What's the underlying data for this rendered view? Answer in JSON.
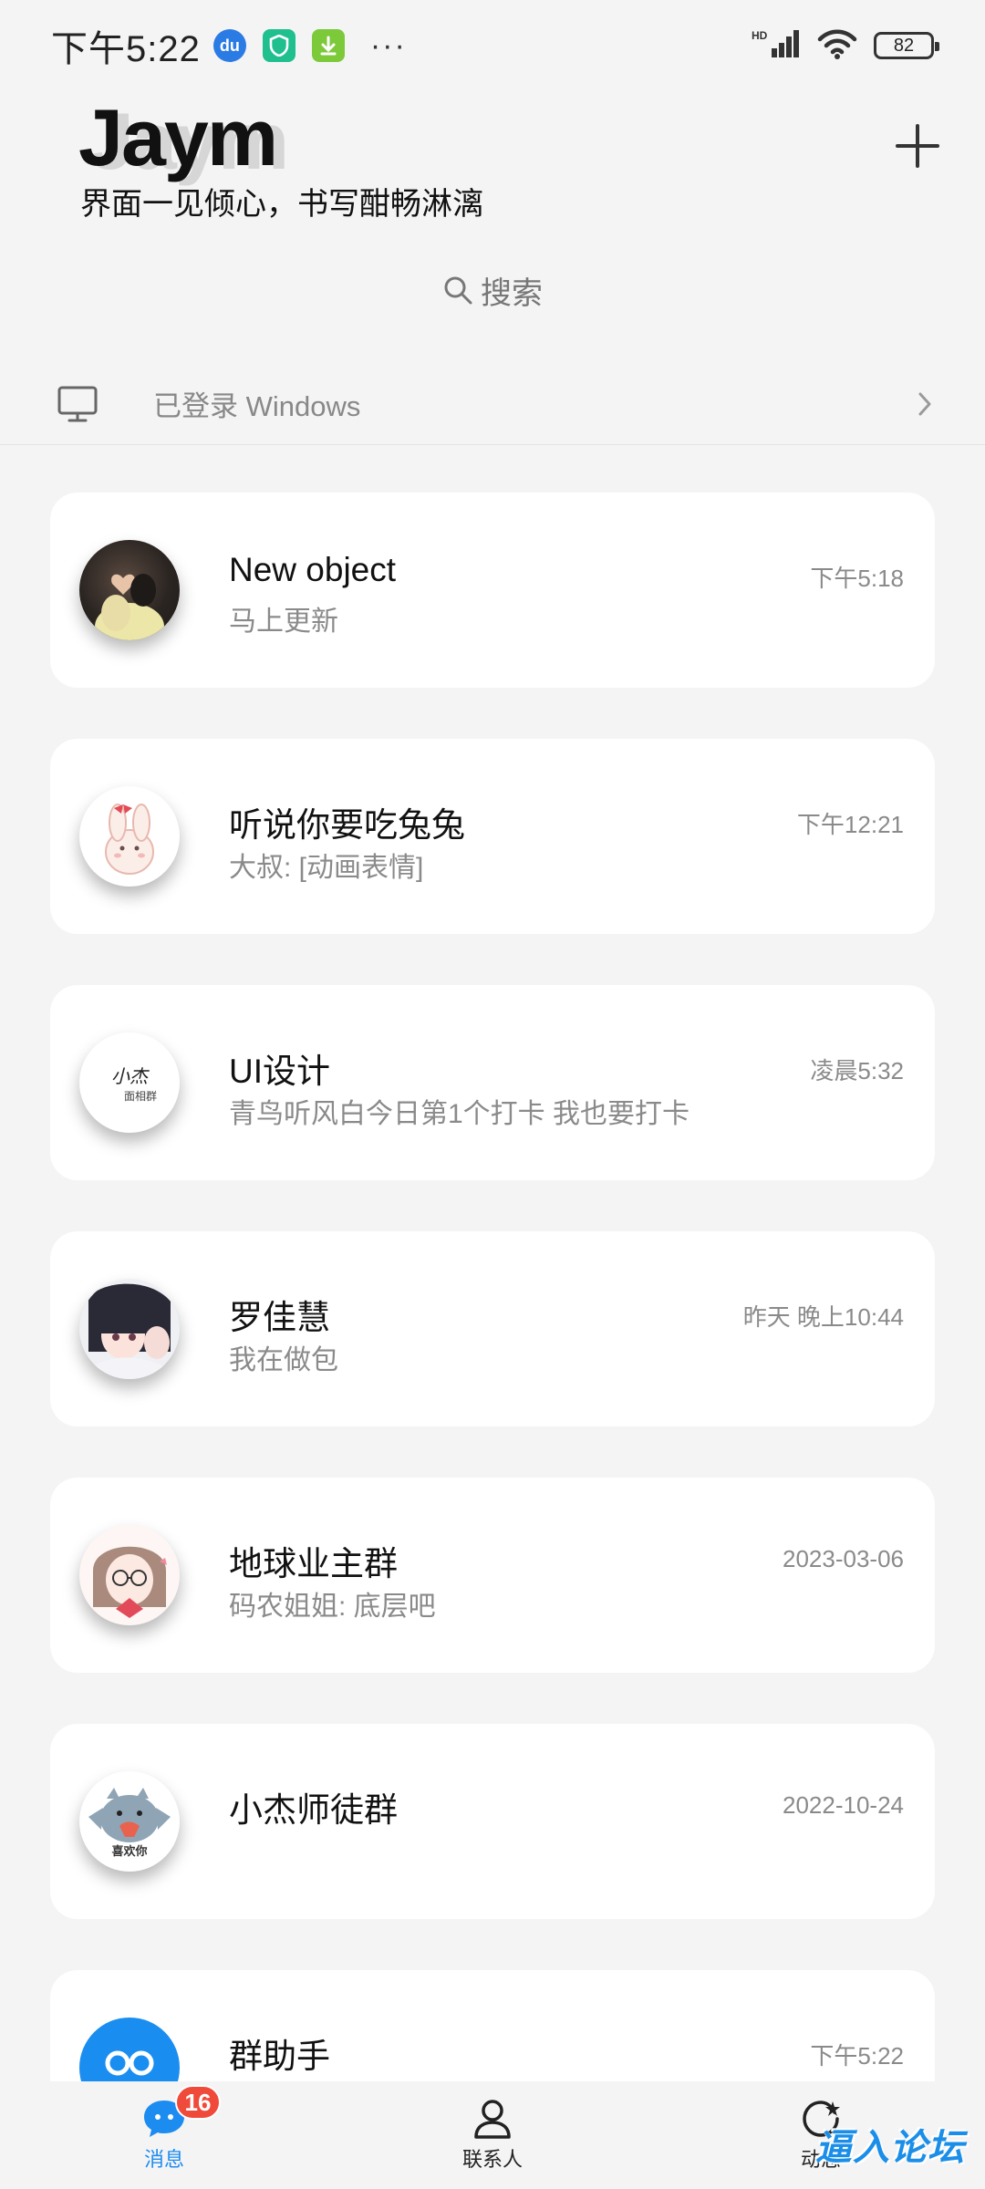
{
  "status_bar": {
    "time": "下午5:22",
    "apps": [
      "du",
      "shield-app",
      "download-app"
    ],
    "more": "···",
    "network": "HD",
    "battery": "82"
  },
  "header": {
    "title": "Jaym",
    "subtitle": "界面一见倾心，书写酣畅淋漓",
    "add_icon": "plus-icon"
  },
  "search": {
    "placeholder": "搜索",
    "icon": "search-icon"
  },
  "login_row": {
    "text": "已登录 Windows",
    "icon": "monitor-icon"
  },
  "chats": [
    {
      "name": "New object",
      "preview": "马上更新",
      "time": "下午5:18"
    },
    {
      "name": "听说你要吃兔兔",
      "preview": "大叔: [动画表情]",
      "time": "下午12:21"
    },
    {
      "name": "UI设计",
      "preview": "青鸟听风白今日第1个打卡  我也要打卡",
      "time": "凌晨5:32"
    },
    {
      "name": "罗佳慧",
      "preview": "我在做包",
      "time": "昨天 晚上10:44"
    },
    {
      "name": "地球业主群",
      "preview": "码农姐姐: 底层吧",
      "time": "2023-03-06"
    },
    {
      "name": "小杰师徒群",
      "preview": "",
      "time": "2022-10-24"
    },
    {
      "name": "群助手",
      "preview": "",
      "time": "下午5:22"
    }
  ],
  "avatar_texts": {
    "ui_design": "小杰",
    "ui_design_sub": "面相群",
    "xiaojie": "喜欢你"
  },
  "tabs": [
    {
      "label": "消息",
      "badge": "16",
      "icon": "chat-bubble-icon"
    },
    {
      "label": "联系人",
      "icon": "person-icon"
    },
    {
      "label": "动态",
      "icon": "refresh-star-icon"
    }
  ],
  "watermark": "逼入论坛",
  "colors": {
    "accent": "#1c8cf0",
    "badge": "#f04a3a",
    "background": "#f4f4f4"
  }
}
